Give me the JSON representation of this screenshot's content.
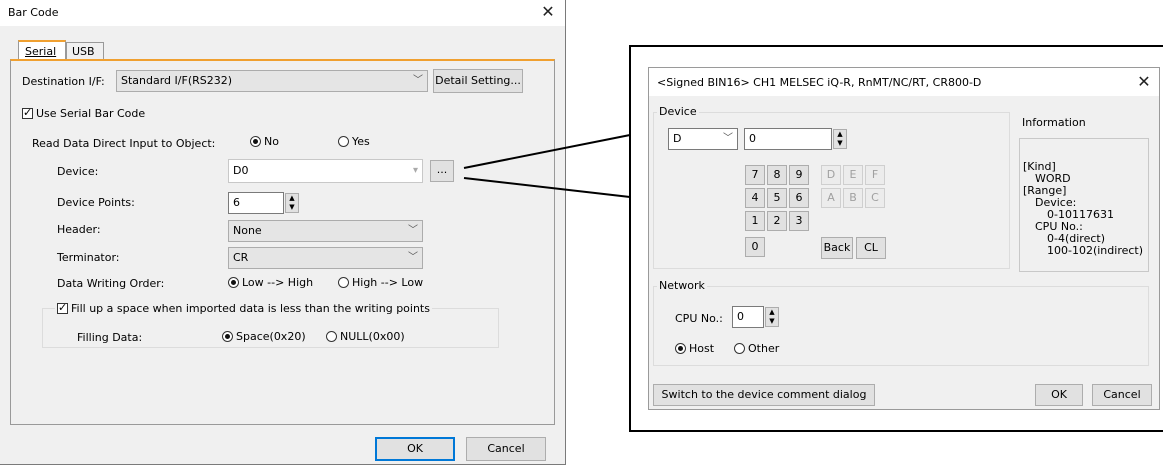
{
  "bar_code": {
    "title": "Bar Code",
    "tabs": [
      {
        "label": "Serial"
      },
      {
        "label": "USB"
      }
    ],
    "destination": {
      "label": "Destination I/F:",
      "value": "Standard I/F(RS232)",
      "detail_button": "Detail Setting..."
    },
    "use_serial": {
      "label": "Use Serial Bar Code",
      "checked": true
    },
    "read_direct": {
      "label": "Read Data Direct Input to Object:",
      "options": [
        "No",
        "Yes"
      ],
      "selected": "No"
    },
    "device": {
      "label": "Device:",
      "value": "D0",
      "browse": "..."
    },
    "points": {
      "label": "Device Points:",
      "value": "6"
    },
    "header": {
      "label": "Header:",
      "value": "None"
    },
    "terminator": {
      "label": "Terminator:",
      "value": "CR"
    },
    "writing_order": {
      "label": "Data Writing Order:",
      "options": [
        "Low --> High",
        "High --> Low"
      ],
      "selected": "Low --> High"
    },
    "fill_up": {
      "label": "Fill up a space when imported data is less than the writing points",
      "checked": true
    },
    "filling": {
      "label": "Filling Data:",
      "options": [
        "Space(0x20)",
        "NULL(0x00)"
      ],
      "selected": "Space(0x20)"
    },
    "ok": "OK",
    "cancel": "Cancel"
  },
  "device_dialog": {
    "title": "<Signed BIN16> CH1 MELSEC iQ-R, RnMT/NC/RT, CR800-D",
    "device_group": "Device",
    "device_type": "D",
    "device_number": "0",
    "keys": [
      {
        "label": "7",
        "enabled": true
      },
      {
        "label": "8",
        "enabled": true
      },
      {
        "label": "9",
        "enabled": true
      },
      {
        "label": "D",
        "enabled": false
      },
      {
        "label": "E",
        "enabled": false
      },
      {
        "label": "F",
        "enabled": false
      },
      {
        "label": "4",
        "enabled": true
      },
      {
        "label": "5",
        "enabled": true
      },
      {
        "label": "6",
        "enabled": true
      },
      {
        "label": "A",
        "enabled": false
      },
      {
        "label": "B",
        "enabled": false
      },
      {
        "label": "C",
        "enabled": false
      },
      {
        "label": "1",
        "enabled": true
      },
      {
        "label": "2",
        "enabled": true
      },
      {
        "label": "3",
        "enabled": true
      },
      {
        "label": "0",
        "enabled": true
      }
    ],
    "back": "Back",
    "clear": "CL",
    "information_label": "Information",
    "info": {
      "kind_label": "[Kind]",
      "kind": "WORD",
      "range_label": "[Range]",
      "device_label": "Device:",
      "device_range": "0-10117631",
      "cpu_label": "CPU No.:",
      "cpu_direct": "0-4(direct)",
      "cpu_indirect": "100-102(indirect)"
    },
    "network_group": "Network",
    "cpu_no_label": "CPU No.:",
    "cpu_no_value": "0",
    "station_options": [
      "Host",
      "Other"
    ],
    "station_selected": "Host",
    "switch_button": "Switch to the device comment dialog",
    "ok": "OK",
    "cancel": "Cancel"
  }
}
